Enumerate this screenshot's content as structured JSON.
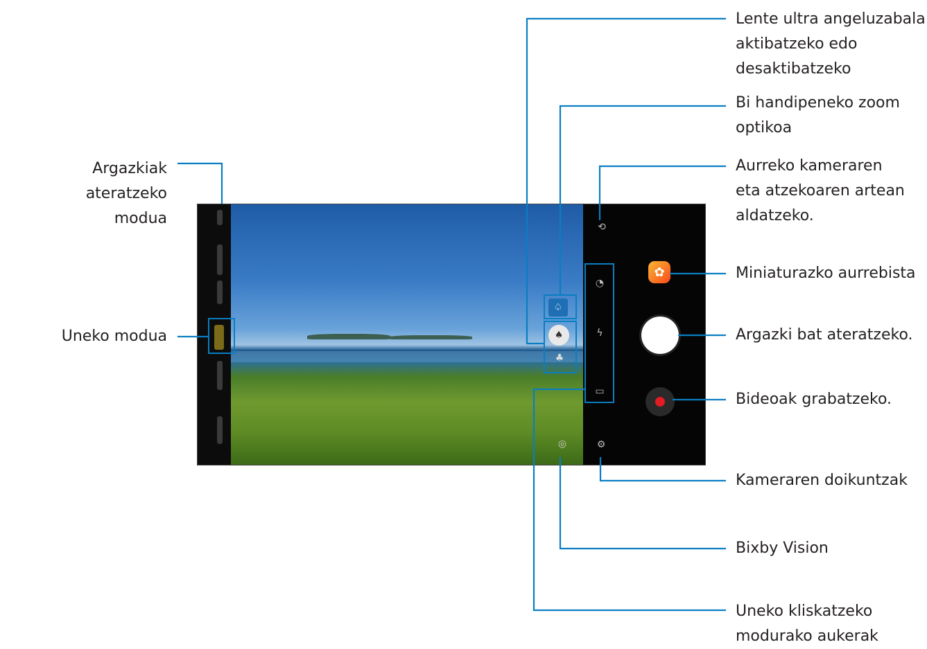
{
  "labels": {
    "shooting_mode": "Argazkiak ateratzeko\nmodua",
    "current_mode": "Uneko modua",
    "ultra_wide": "Lente ultra angeluzabala\naktibatzeko edo\ndesaktibatzeko",
    "optical_zoom": "Bi handipeneko zoom\noptikoa",
    "switch_camera": "Aurreko kameraren\neta atzekoaren artean\naldatzeko.",
    "preview_thumbnail": "Miniaturazko aurrebista",
    "take_picture": "Argazki bat ateratzeko.",
    "record_video": "Bideoak grabatzeko.",
    "camera_settings": "Kameraren doikuntzak",
    "bixby_vision": "Bixby Vision",
    "shooting_options": "Uneko kliskatzeko\nmodurako aukerak"
  },
  "icons": {
    "wide_lens": "tree-icon",
    "zoom": "tree-icon",
    "zoom2": "tree-icon",
    "switch_camera": "camera-switch-icon",
    "gallery": "gallery-thumbnail-icon",
    "hdr": "hdr-icon",
    "flash": "flash-off-icon",
    "ratio": "aspect-ratio-icon",
    "bixby": "bixby-eye-icon",
    "settings": "gear-icon"
  },
  "colors": {
    "callout_line": "#0a7ec2",
    "record_dot": "#e31b23"
  }
}
